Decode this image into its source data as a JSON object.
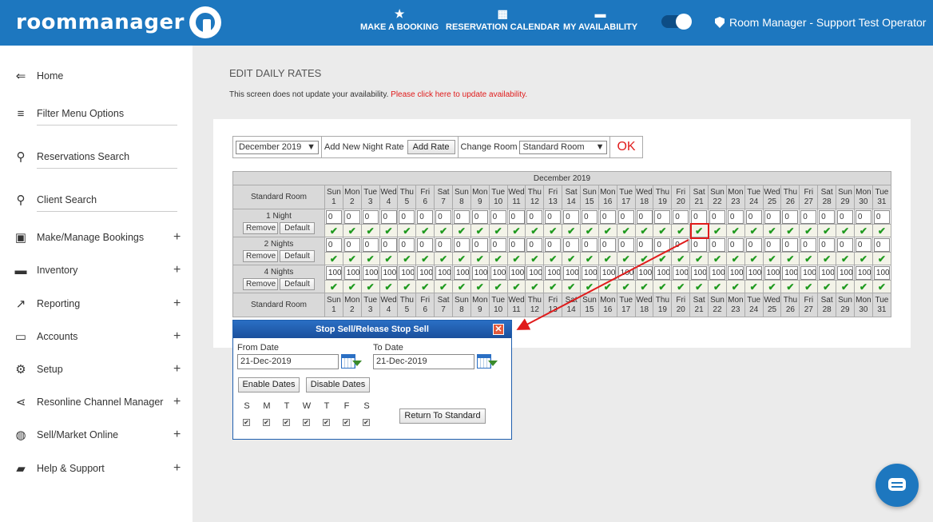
{
  "header": {
    "logo_text": "roommanager",
    "nav": [
      {
        "label": "MAKE A BOOKING",
        "icon": "star-icon"
      },
      {
        "label": "RESERVATION CALENDAR",
        "icon": "calendar-icon"
      },
      {
        "label": "MY AVAILABILITY",
        "icon": "bed-icon"
      }
    ],
    "operator": "Room Manager - Support Test Operator"
  },
  "sidebar": {
    "items": [
      {
        "label": "Home",
        "icon": "back-arrow-icon",
        "expandable": false
      },
      {
        "label": "Filter Menu Options",
        "icon": "filter-icon",
        "expandable": false
      },
      {
        "label": "Reservations Search",
        "icon": "search-icon",
        "expandable": false
      },
      {
        "label": "Client Search",
        "icon": "search-icon",
        "expandable": false
      },
      {
        "label": "Make/Manage Bookings",
        "icon": "calendar-check-icon",
        "expandable": true
      },
      {
        "label": "Inventory",
        "icon": "bed-icon",
        "expandable": true
      },
      {
        "label": "Reporting",
        "icon": "trending-icon",
        "expandable": true
      },
      {
        "label": "Accounts",
        "icon": "card-icon",
        "expandable": true
      },
      {
        "label": "Setup",
        "icon": "gear-icon",
        "expandable": true
      },
      {
        "label": "Resonline Channel Manager",
        "icon": "share-icon",
        "expandable": true
      },
      {
        "label": "Sell/Market Online",
        "icon": "globe-icon",
        "expandable": true
      },
      {
        "label": "Help & Support",
        "icon": "chat-icon",
        "expandable": true
      }
    ],
    "plus_symbol": "+"
  },
  "main": {
    "title": "EDIT DAILY RATES",
    "notice_text": "This screen does not update your availability. ",
    "notice_link": "Please click here to update availability."
  },
  "toolbar": {
    "month_value": "December 2019",
    "add_label": "Add New Night Rate",
    "add_button": "Add Rate",
    "room_label": "Change Room",
    "room_value": "Standard Room",
    "ok_label": "OK"
  },
  "grid": {
    "month": "December 2019",
    "room_header": "Standard Room",
    "days": [
      {
        "dow": "Sun",
        "num": "1"
      },
      {
        "dow": "Mon",
        "num": "2"
      },
      {
        "dow": "Tue",
        "num": "3"
      },
      {
        "dow": "Wed",
        "num": "4"
      },
      {
        "dow": "Thu",
        "num": "5"
      },
      {
        "dow": "Fri",
        "num": "6"
      },
      {
        "dow": "Sat",
        "num": "7"
      },
      {
        "dow": "Sun",
        "num": "8"
      },
      {
        "dow": "Mon",
        "num": "9"
      },
      {
        "dow": "Tue",
        "num": "10"
      },
      {
        "dow": "Wed",
        "num": "11"
      },
      {
        "dow": "Thu",
        "num": "12"
      },
      {
        "dow": "Fri",
        "num": "13"
      },
      {
        "dow": "Sat",
        "num": "14"
      },
      {
        "dow": "Sun",
        "num": "15"
      },
      {
        "dow": "Mon",
        "num": "16"
      },
      {
        "dow": "Tue",
        "num": "17"
      },
      {
        "dow": "Wed",
        "num": "18"
      },
      {
        "dow": "Thu",
        "num": "19"
      },
      {
        "dow": "Fri",
        "num": "20"
      },
      {
        "dow": "Sat",
        "num": "21"
      },
      {
        "dow": "Sun",
        "num": "22"
      },
      {
        "dow": "Mon",
        "num": "23"
      },
      {
        "dow": "Tue",
        "num": "24"
      },
      {
        "dow": "Wed",
        "num": "25"
      },
      {
        "dow": "Thu",
        "num": "26"
      },
      {
        "dow": "Fri",
        "num": "27"
      },
      {
        "dow": "Sat",
        "num": "28"
      },
      {
        "dow": "Sun",
        "num": "29"
      },
      {
        "dow": "Mon",
        "num": "30"
      },
      {
        "dow": "Tue",
        "num": "31"
      }
    ],
    "rates": [
      {
        "label": "1 Night",
        "value": "0"
      },
      {
        "label": "2 Nights",
        "value": "0"
      },
      {
        "label": "4 Nights",
        "value": "100"
      }
    ],
    "remove_label": "Remove",
    "default_label": "Default",
    "check_mark": "✔"
  },
  "dialog": {
    "title": "Stop Sell/Release Stop Sell",
    "close": "✕",
    "from_label": "From Date",
    "from_value": "21-Dec-2019",
    "to_label": "To Date",
    "to_value": "21-Dec-2019",
    "enable_button": "Enable Dates",
    "disable_button": "Disable Dates",
    "days": [
      "S",
      "M",
      "T",
      "W",
      "T",
      "F",
      "S"
    ],
    "return_button": "Return To Standard",
    "check": "✔"
  },
  "colors": {
    "brand": "#1d77bf",
    "alert": "#e01b1b",
    "check": "#1f9a1f"
  }
}
